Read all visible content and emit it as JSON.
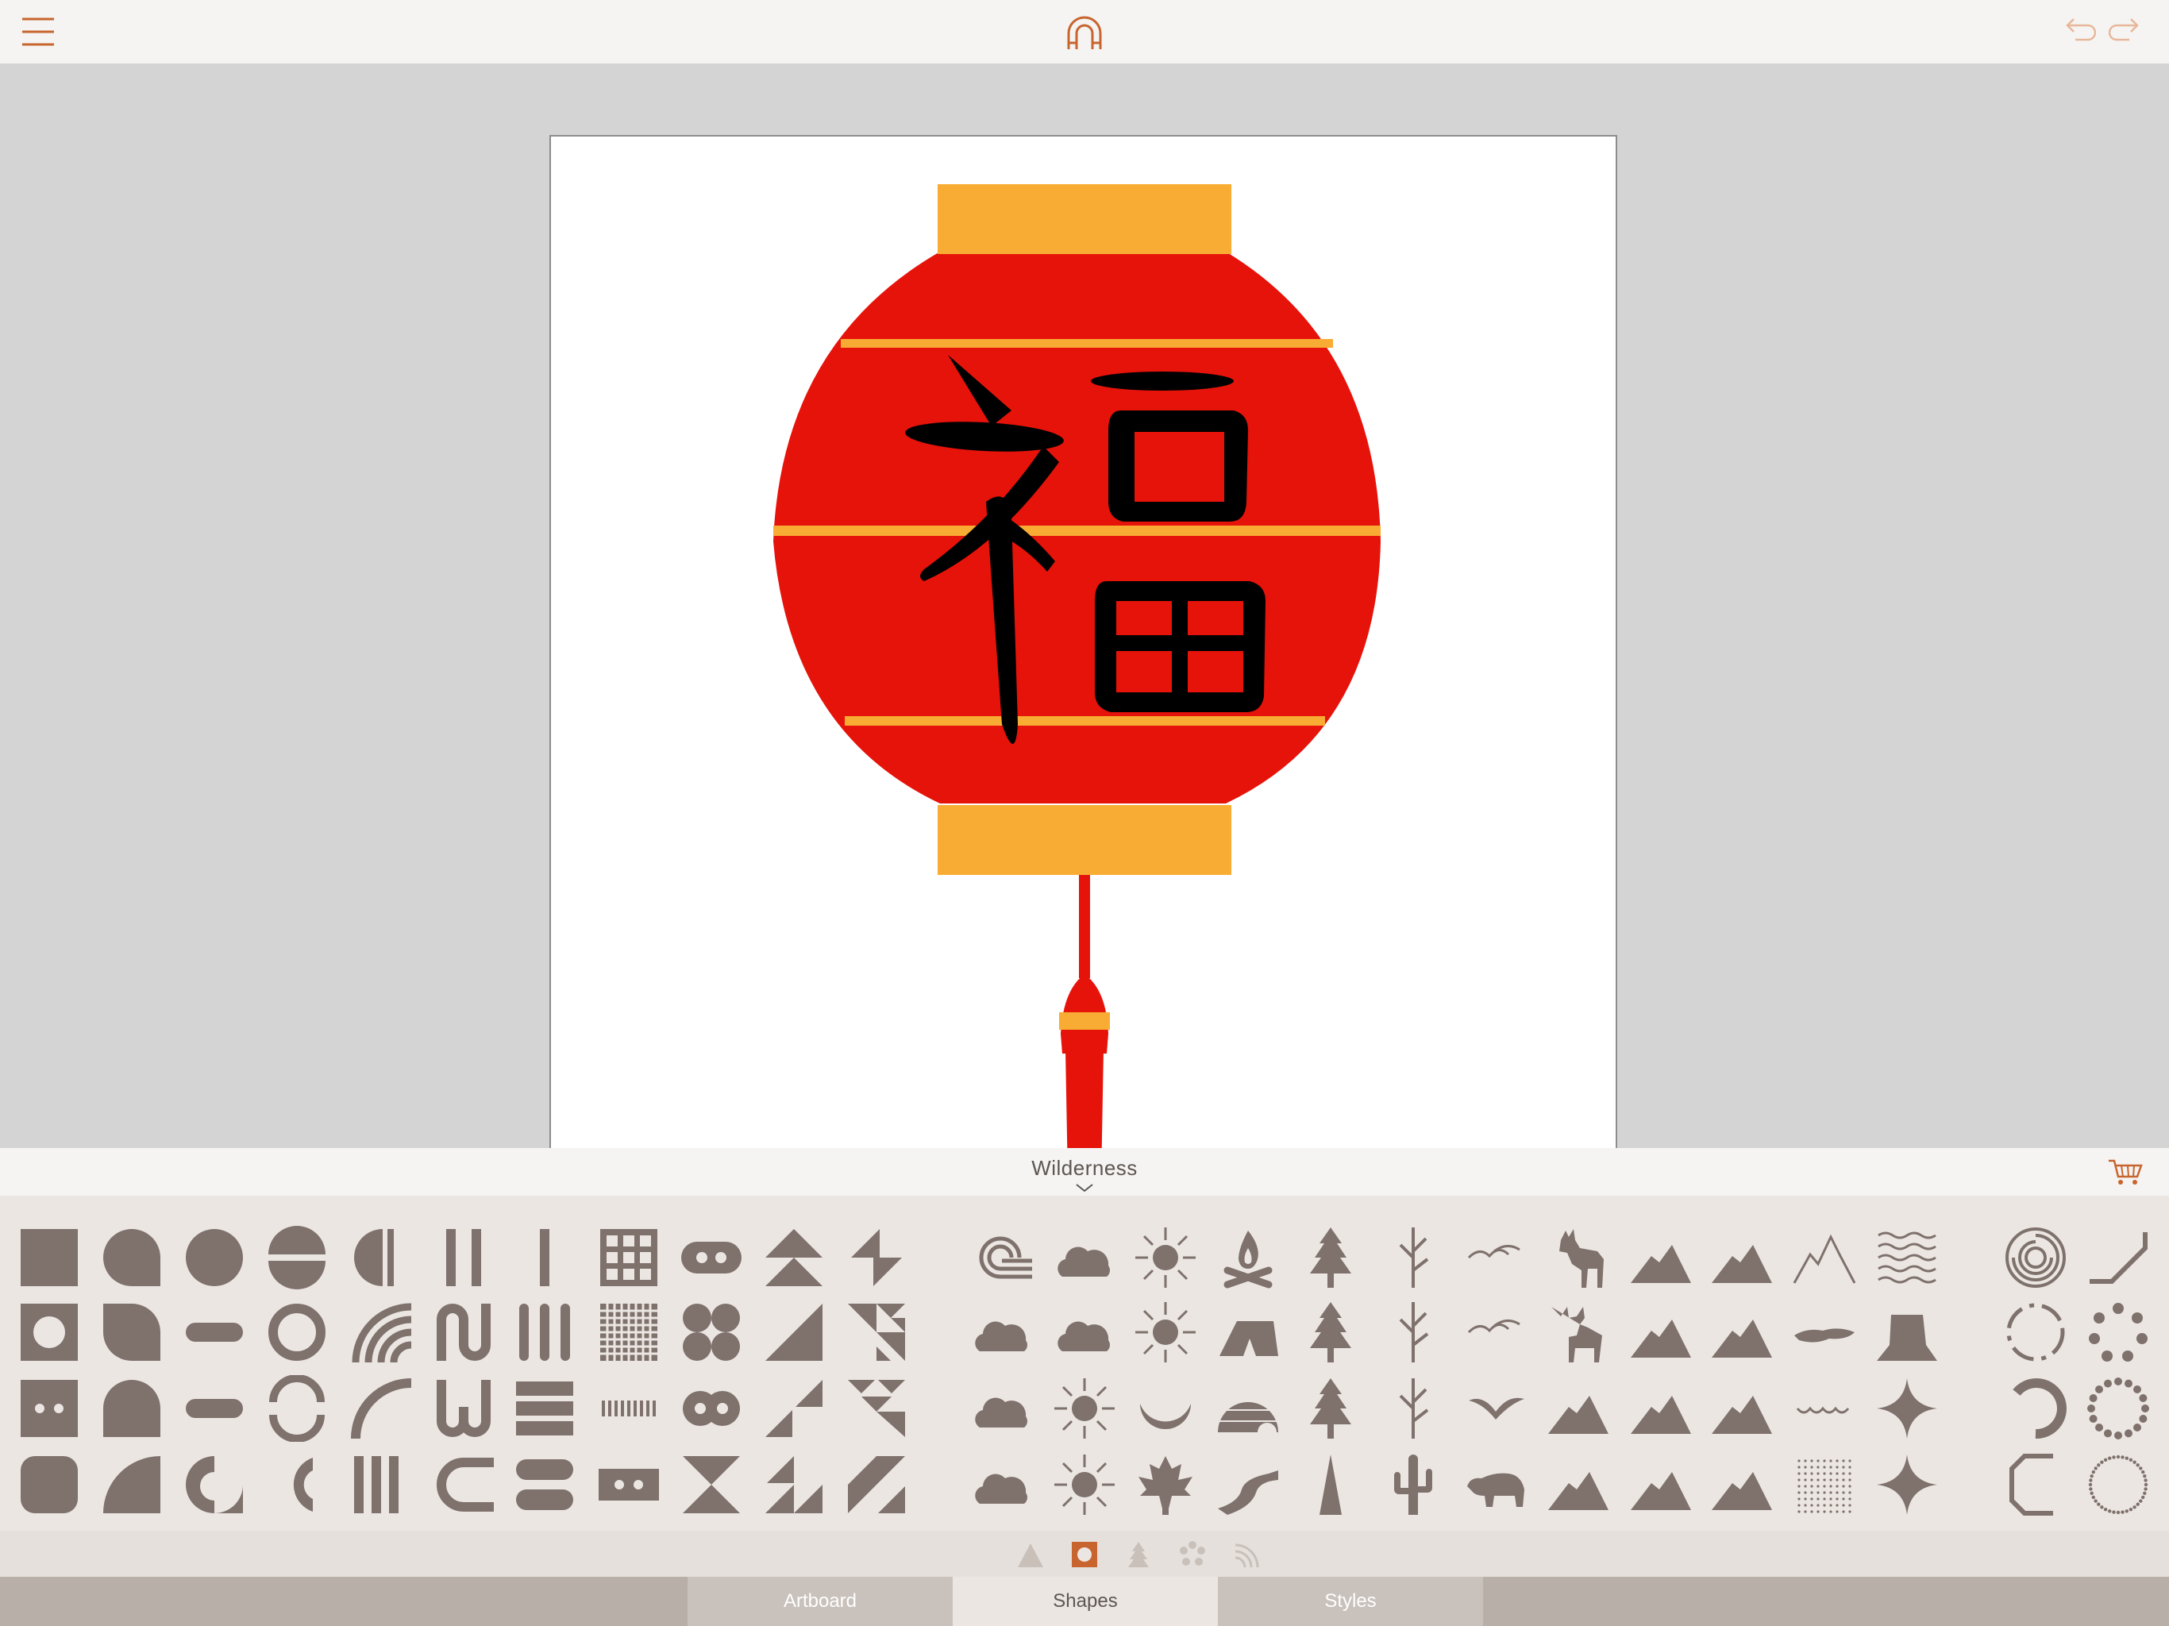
{
  "toolbar": {
    "menu_icon": "hamburger-icon",
    "app_logo": "magnet-icon",
    "undo_icon": "undo-icon",
    "redo_icon": "redo-icon",
    "accent_color": "#c8642e"
  },
  "artboard": {
    "background": "#ffffff",
    "lantern_colors": {
      "body": "#e6130a",
      "caps": "#f8ac33",
      "glyph": "#000000"
    },
    "glyph": "福"
  },
  "shape_pack": {
    "title": "Wilderness",
    "cart_icon": "shopping-cart-icon",
    "shape_color": "#7f716c"
  },
  "shapes": [
    "square",
    "drop-rounded",
    "circle",
    "split-circle",
    "half-circle",
    "bar-pair",
    "bar",
    "grid-3x3",
    "pill-dots",
    "triangle-stack",
    "zigzag-triangles",
    "square-hole",
    "leaf",
    "pill",
    "ring",
    "rainbow-arcs",
    "wave-loop",
    "triple-bars",
    "grid-dense",
    "four-circles",
    "triangle",
    "triangle-pattern",
    "dot-square",
    "tomb",
    "pill",
    "broken-ring",
    "quarter-arc",
    "w-loops",
    "striped-square",
    "ticks",
    "figure-eight",
    "triangle-split",
    "triangle-diamonds",
    "rounded-square",
    "quarter-circle",
    "drop-ring",
    "crescent-c",
    "striped-bars",
    "c-stripes",
    "pill-stack",
    "dot-rect",
    "hourglass",
    "sawtooth",
    "diagonal-stripe",
    "wind-icon",
    "cloud-icon",
    "sun-icon",
    "campfire-icon",
    "pine-tree-icon",
    "branch-icon",
    "birds-icon",
    "deer-icon",
    "mountain-icon",
    "mountain-icon",
    "mountain-peaks-icon",
    "waves-icon",
    "cloud-icon",
    "cloud-icon",
    "sun-icon",
    "tent-icon",
    "pine-tree-icon",
    "branch-icon",
    "birds-icon",
    "moose-icon",
    "mountain-icon",
    "mountain-icon",
    "lake-icon",
    "mesa-icon",
    "cloud-icon",
    "sun-icon",
    "moon-icon",
    "igloo-icon",
    "pine-tree-icon",
    "branch-icon",
    "bird-icon",
    "mountain-icon",
    "mountain-icon",
    "mountain-icon",
    "ripples-icon",
    "sparkle-icon",
    "cloud-icon",
    "sun-icon",
    "maple-leaf-icon",
    "river-icon",
    "cypress-icon",
    "cactus-icon",
    "bear-icon",
    "mountain-icon",
    "mountain-icon",
    "mountain-icon",
    "dots-texture-icon",
    "sparkle-icon",
    "spiral-circle-icon",
    "corner-line-icon",
    "dashed-circle-icon",
    "dot-circle-icon",
    "broken-circle-icon",
    "dot-ring-icon",
    "bracket-icon",
    "dotted-circle-icon"
  ],
  "categories": [
    {
      "icon": "triangle-icon",
      "active": false
    },
    {
      "icon": "square-icon",
      "active": true
    },
    {
      "icon": "tree-icon",
      "active": false
    },
    {
      "icon": "flower-icon",
      "active": false
    },
    {
      "icon": "rainbow-icon",
      "active": false
    }
  ],
  "tabs": [
    {
      "label": "Artboard",
      "active": false
    },
    {
      "label": "Shapes",
      "active": true
    },
    {
      "label": "Styles",
      "active": false
    }
  ]
}
